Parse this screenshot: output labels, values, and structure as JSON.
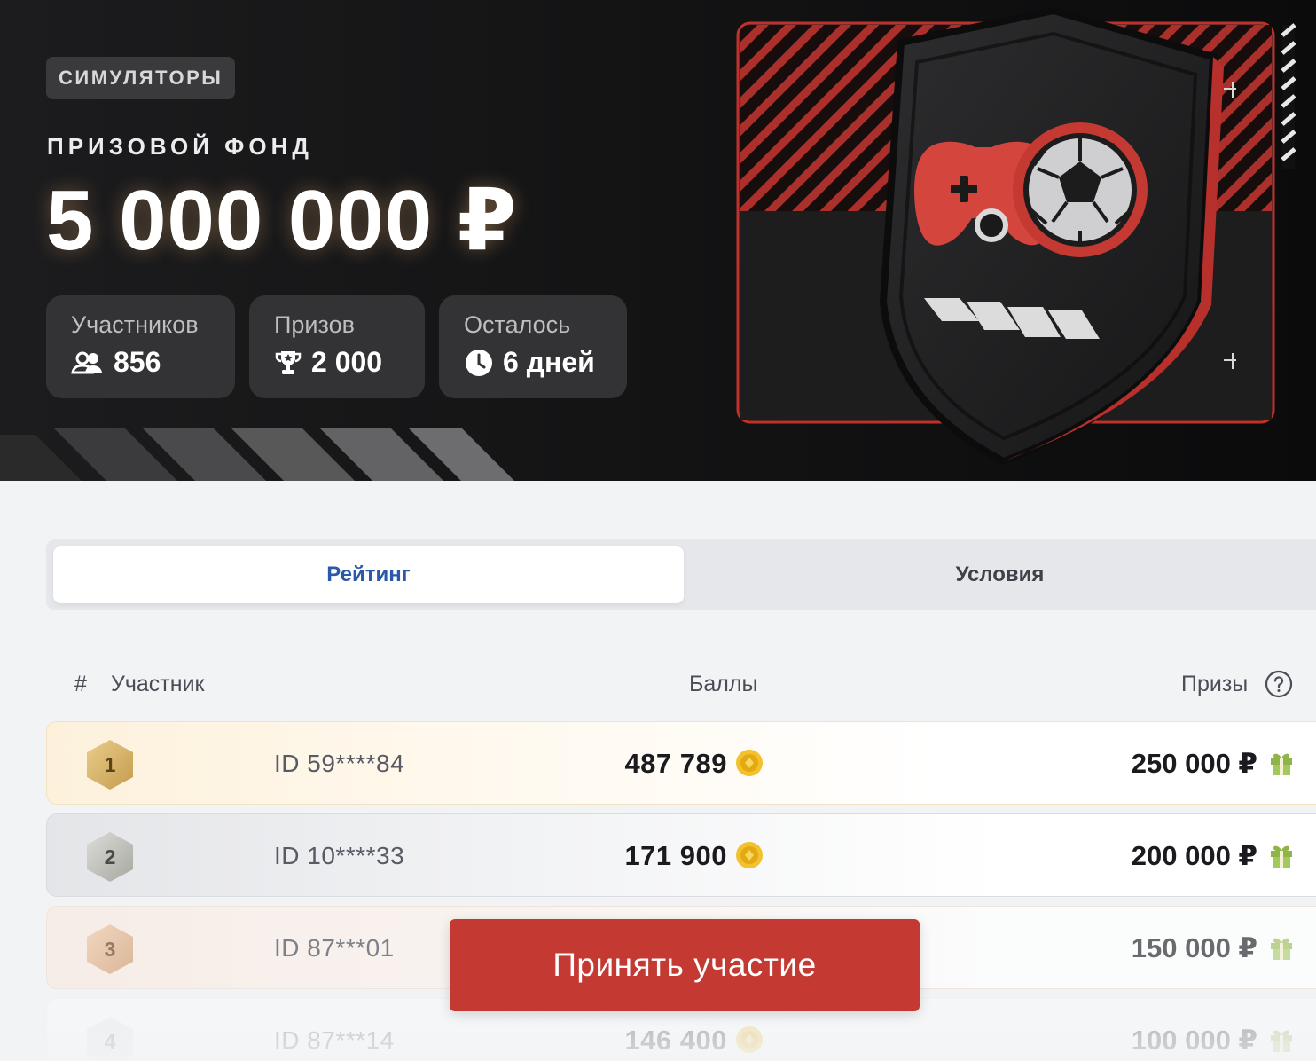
{
  "hero": {
    "tag": "СИМУЛЯТОРЫ",
    "fund_label": "ПРИЗОВОЙ ФОНД",
    "fund_amount": "5 000 000 ₽",
    "stats": [
      {
        "label": "Участников",
        "value": "856",
        "icon": "users-icon"
      },
      {
        "label": "Призов",
        "value": "2 000",
        "icon": "trophy-icon"
      },
      {
        "label": "Осталось",
        "value": "6 дней",
        "icon": "clock-icon"
      }
    ],
    "art_icon": "shield-gamepad-ball-icon",
    "colors": {
      "accent": "#c43a33",
      "hero_bg": "#141415"
    }
  },
  "tabs": [
    {
      "label": "Рейтинг",
      "active": true
    },
    {
      "label": "Условия",
      "active": false
    }
  ],
  "table": {
    "headers": {
      "rank": "#",
      "participant": "Участник",
      "points": "Баллы",
      "prizes": "Призы"
    },
    "rows": [
      {
        "rank": "1",
        "id": "ID 59****84",
        "points": "487 789",
        "prize": "250 000 ₽",
        "medal": "gold"
      },
      {
        "rank": "2",
        "id": "ID 10****33",
        "points": "171 900",
        "prize": "200 000 ₽",
        "medal": "silver"
      },
      {
        "rank": "3",
        "id": "ID 87***01",
        "points": "",
        "prize": "150 000 ₽",
        "medal": "bronze"
      },
      {
        "rank": "4",
        "id": "ID 87***14",
        "points": "146 400",
        "prize": "100 000 ₽",
        "medal": "plain"
      }
    ]
  },
  "cta": {
    "label": "Принять участие"
  }
}
